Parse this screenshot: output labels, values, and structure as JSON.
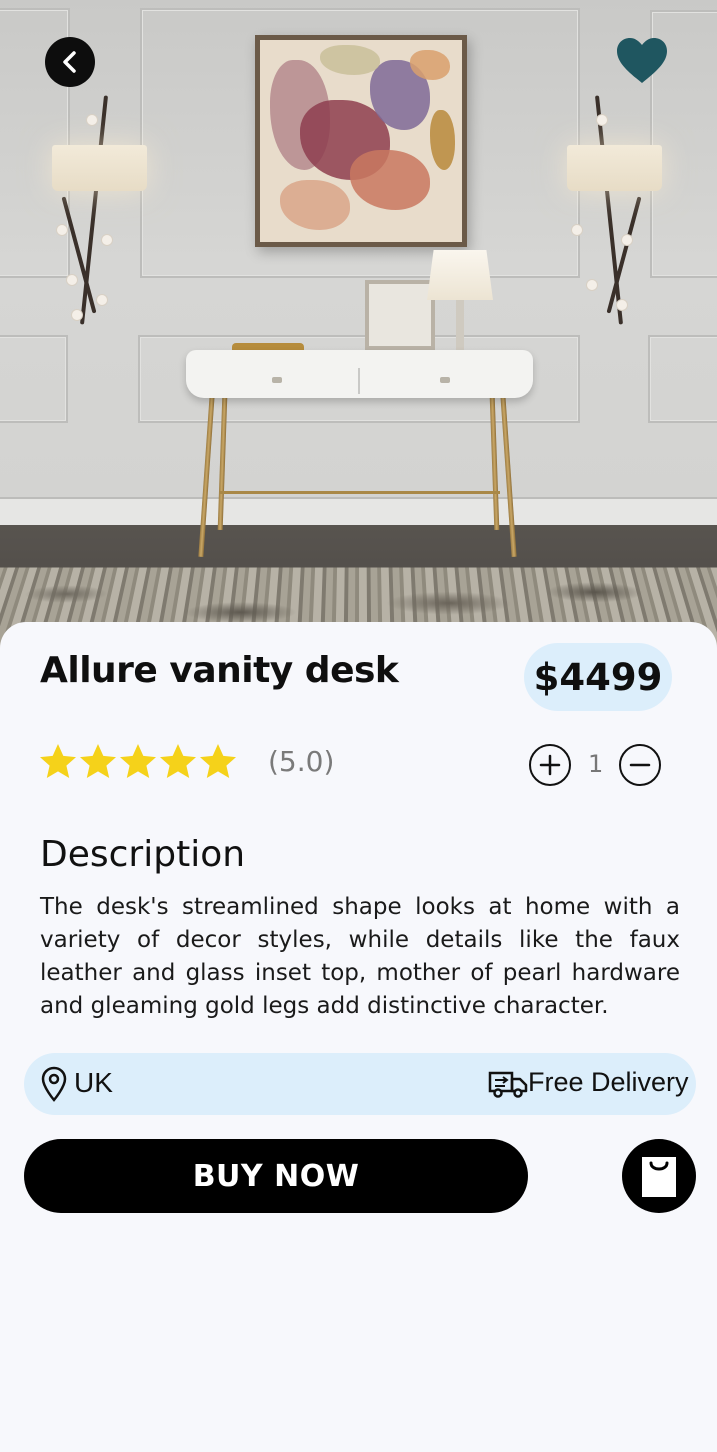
{
  "product": {
    "title": "Allure vanity desk",
    "price": "$4499",
    "rating_value": 5.0,
    "rating_text": "(5.0)",
    "stars_filled": 5,
    "stars_total": 5,
    "quantity": "1"
  },
  "description": {
    "heading": "Description",
    "text": "The desk's streamlined shape looks at home with a variety of decor styles, while details like the faux leather and glass inset top, mother of pearl hardware and gleaming gold legs add distinctive character."
  },
  "info": {
    "location": "UK",
    "delivery": "Free Delivery"
  },
  "actions": {
    "buy_label": "BUY NOW"
  },
  "icons": {
    "back": "chevron-left-icon",
    "favorite": "heart-icon",
    "location": "map-pin-icon",
    "delivery": "truck-icon",
    "cart": "shopping-bag-icon",
    "increase": "plus-icon",
    "decrease": "minus-icon"
  },
  "colors": {
    "accent_pill": "#dceefb",
    "heart": "#1f5660",
    "star": "#f5d21a",
    "button": "#000000"
  }
}
